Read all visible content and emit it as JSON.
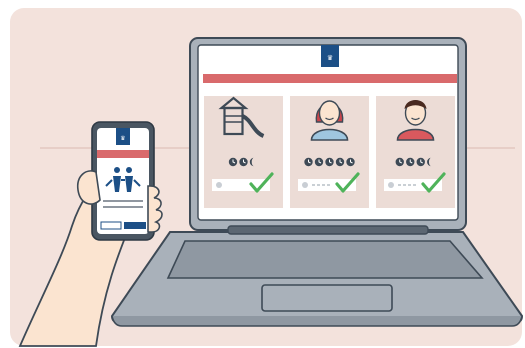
{
  "colors": {
    "background": "#f3e2dc",
    "laptop_body": "#a9b1ba",
    "laptop_dark": "#3e4a56",
    "screen": "#ffffff",
    "banner_red": "#d96a6c",
    "card_bg": "#ecdcd6",
    "logo_blue": "#1c4f86",
    "check_green": "#4fb35a",
    "skin": "#fbe4d0",
    "hair_red": "#c9454c",
    "hair_dark": "#4a2a20",
    "shirt_blue": "#9fc6df",
    "shirt_red": "#d9595e"
  },
  "icons": {
    "govt_logo": "dutch-government-logo-icon",
    "playground": "playground-icon",
    "woman": "woman-avatar-icon",
    "man": "man-avatar-icon",
    "clock": "clock-icon",
    "check": "checkmark-icon",
    "family": "family-icon"
  },
  "cards": [
    {
      "id": "playground",
      "filled_dots": 2,
      "half_dots": 1,
      "checked": true
    },
    {
      "id": "woman",
      "filled_dots": 5,
      "half_dots": 0,
      "checked": true
    },
    {
      "id": "man",
      "filled_dots": 3,
      "half_dots": 1,
      "checked": true
    }
  ]
}
